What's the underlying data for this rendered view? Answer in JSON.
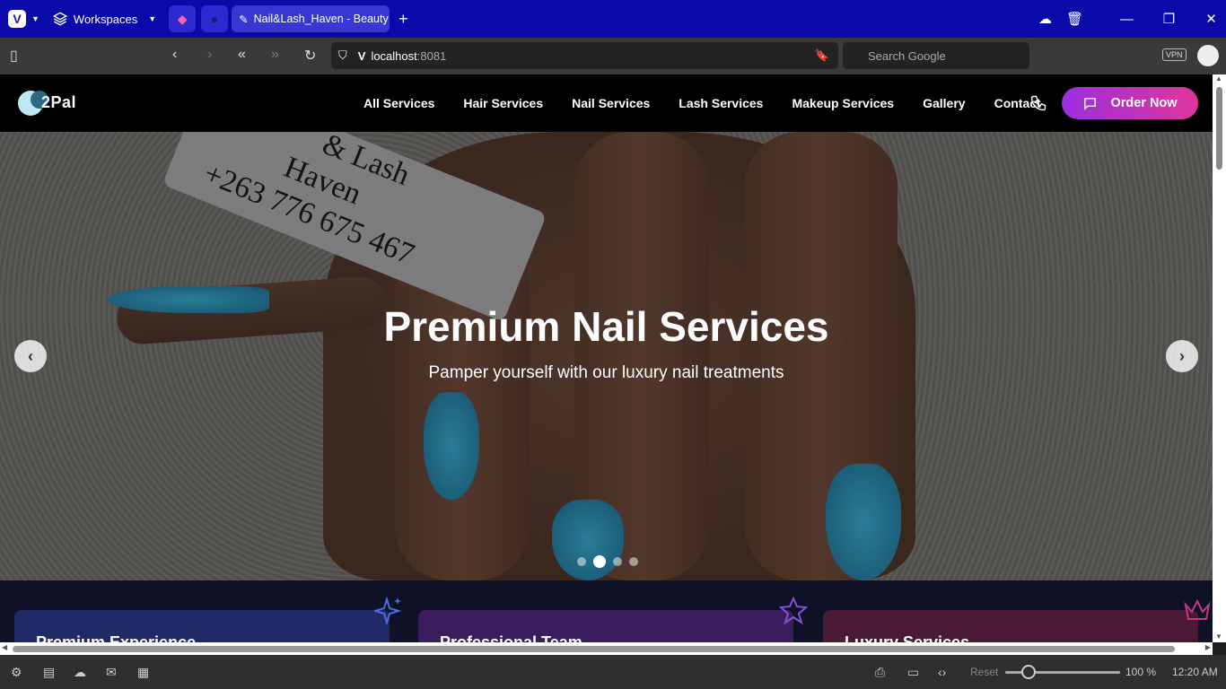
{
  "browser": {
    "workspaces_label": "Workspaces",
    "tab_title": "Nail&Lash_Haven - Beauty",
    "url_host": "localhost",
    "url_port": ":8081",
    "search_placeholder": "Search Google",
    "vpn_label": "VPN"
  },
  "site": {
    "logo_text": "2Pal",
    "menu": [
      "All Services",
      "Hair Services",
      "Nail Services",
      "Lash Services",
      "Makeup Services",
      "Gallery",
      "Contact"
    ],
    "order_button": "Order Now"
  },
  "hero": {
    "title": "Premium Nail Services",
    "subtitle": "Pamper yourself with our luxury nail treatments",
    "photo_card_lines": [
      "& Lash",
      "Haven",
      "+263 776 675 467"
    ],
    "slide_count": 4,
    "active_slide": 2
  },
  "features": [
    {
      "title": "Premium Experience",
      "color": "#1f2a66",
      "icon": "sparkles-icon"
    },
    {
      "title": "Professional Team",
      "color": "#3a1d5c",
      "icon": "star-icon"
    },
    {
      "title": "Luxury Services",
      "color": "#4a1a34",
      "icon": "crown-icon"
    }
  ],
  "statusbar": {
    "reset_label": "Reset",
    "zoom": "100 %",
    "time": "12:20 AM"
  },
  "colors": {
    "titlebar": "#0a0aa8",
    "order_gradient_start": "#9b2ee0",
    "order_gradient_end": "#e0359a"
  }
}
